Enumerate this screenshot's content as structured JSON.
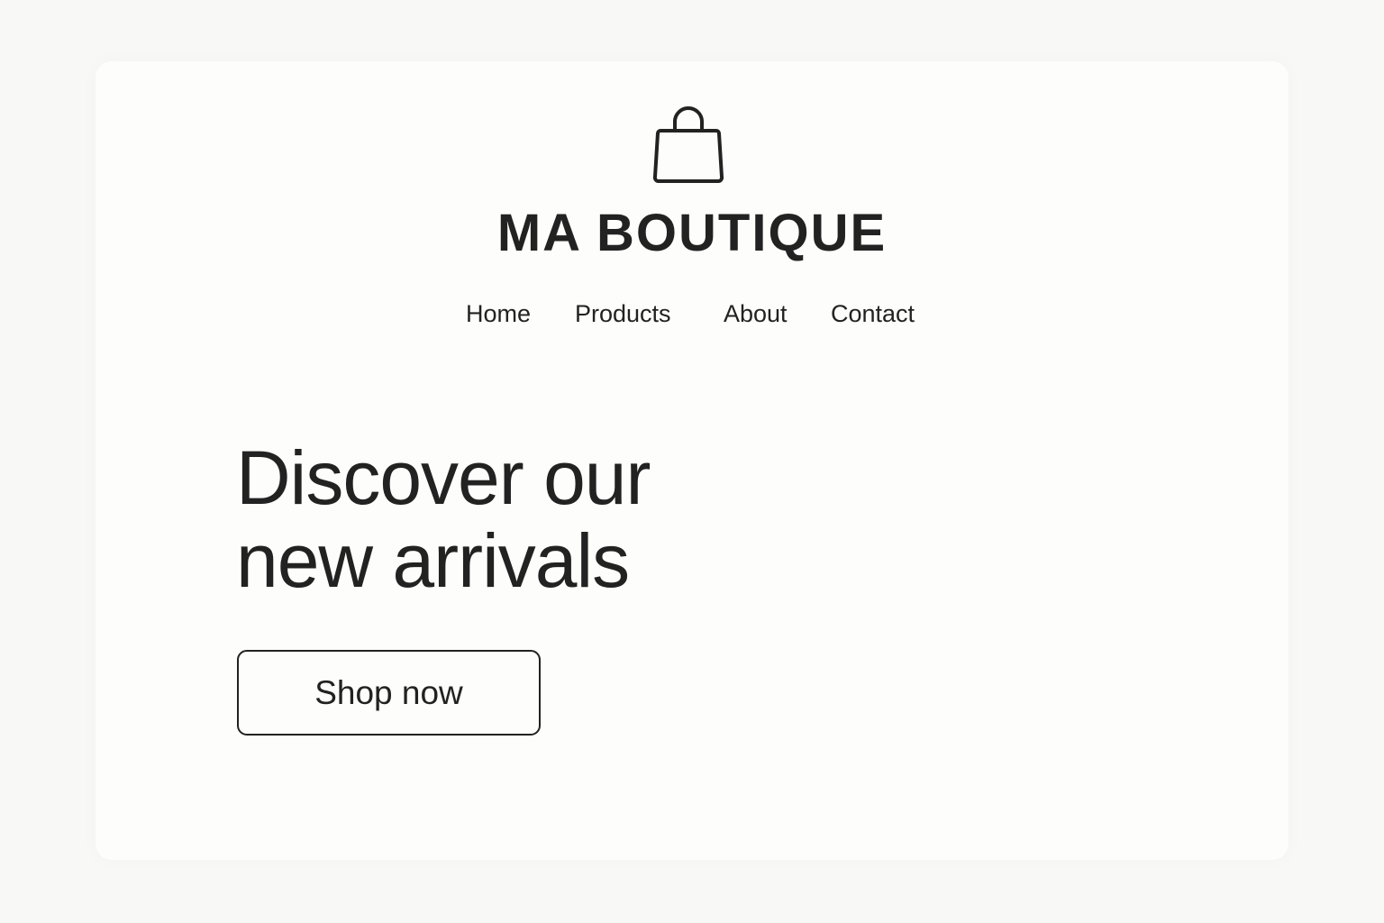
{
  "brand": {
    "icon": "shopping-bag-icon",
    "name": "MA BOUTIQUE"
  },
  "nav": {
    "items": [
      {
        "label": "Home"
      },
      {
        "label": "Products"
      },
      {
        "label": "About"
      },
      {
        "label": "Contact"
      }
    ]
  },
  "hero": {
    "title_line1": "Discover our",
    "title_line2": "new arrivals",
    "cta_label": "Shop now"
  },
  "colors": {
    "page_background": "#f8f8f6",
    "card_background": "#fdfdfb",
    "text": "#222222"
  }
}
